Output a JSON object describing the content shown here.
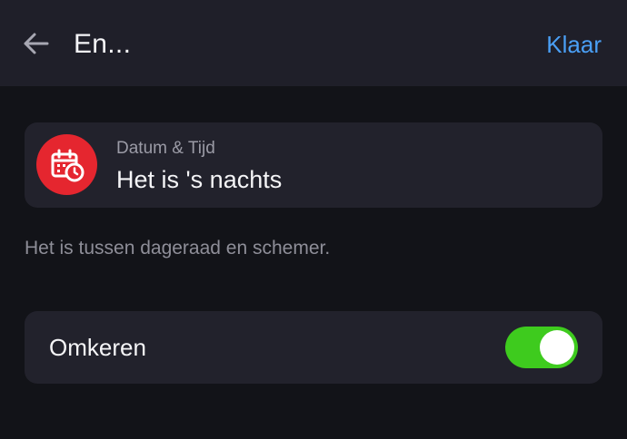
{
  "header": {
    "back_icon": "arrow-left-icon",
    "title": "En...",
    "done_label": "Klaar",
    "accent_color": "#4a9ff5"
  },
  "trigger": {
    "icon": "calendar-clock-icon",
    "icon_bg_color": "#e5262f",
    "category": "Datum & Tijd",
    "value": "Het is 's nachts"
  },
  "description": "Het is tussen dageraad en schemer.",
  "invert": {
    "label": "Omkeren",
    "enabled": true,
    "toggle_color": "#3ecb1e"
  }
}
